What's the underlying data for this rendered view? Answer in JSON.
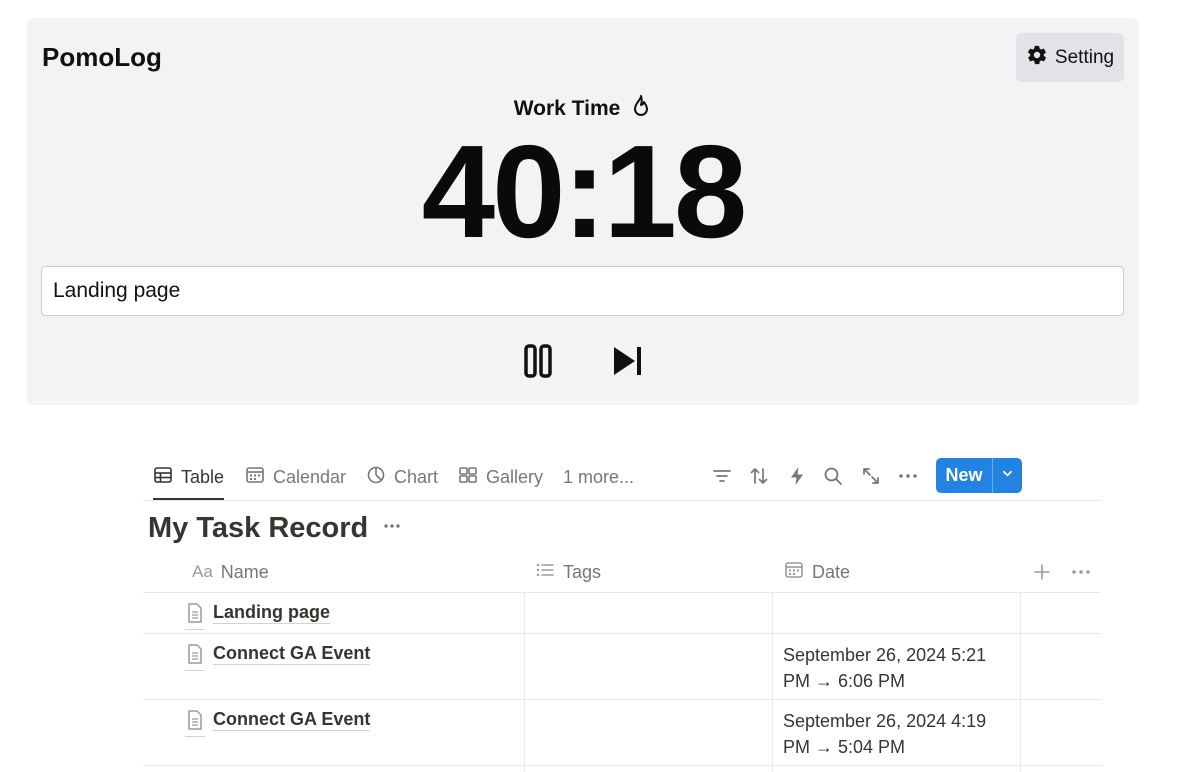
{
  "pomodoro": {
    "app_title": "PomoLog",
    "setting_label": "Setting",
    "mode_label": "Work Time",
    "timer": "40:18",
    "task_value": "Landing page",
    "icons": {
      "setting": "gear-icon",
      "mode": "flame-icon",
      "pause": "pause-icon",
      "skip": "skip-forward-icon"
    }
  },
  "database": {
    "views": [
      {
        "label": "Table",
        "icon": "table-icon"
      },
      {
        "label": "Calendar",
        "icon": "calendar-icon"
      },
      {
        "label": "Chart",
        "icon": "pie-chart-icon"
      },
      {
        "label": "Gallery",
        "icon": "gallery-icon"
      },
      {
        "label": "1 more..."
      }
    ],
    "toolbar_icons": [
      "filter-icon",
      "sort-icon",
      "lightning-icon",
      "search-icon",
      "expand-icon",
      "more-icon"
    ],
    "new_label": "New",
    "title": "My Task Record",
    "columns": [
      {
        "prefix": "Aa",
        "label": "Name"
      },
      {
        "label": "Tags",
        "icon": "list-icon"
      },
      {
        "label": "Date",
        "icon": "calendar-icon"
      }
    ],
    "rows": [
      {
        "name": "Landing page",
        "tags": "",
        "date": ""
      },
      {
        "name": "Connect GA Event",
        "tags": "",
        "date": "September 26, 2024 5:21 PM → 6:06 PM"
      },
      {
        "name": "Connect GA Event",
        "tags": "",
        "date": "September 26, 2024 4:19 PM → 5:04 PM"
      }
    ],
    "colors": {
      "accent": "#2383e2",
      "text": "#37352f",
      "muted": "#787774",
      "panel": "#f2f3f5"
    }
  }
}
